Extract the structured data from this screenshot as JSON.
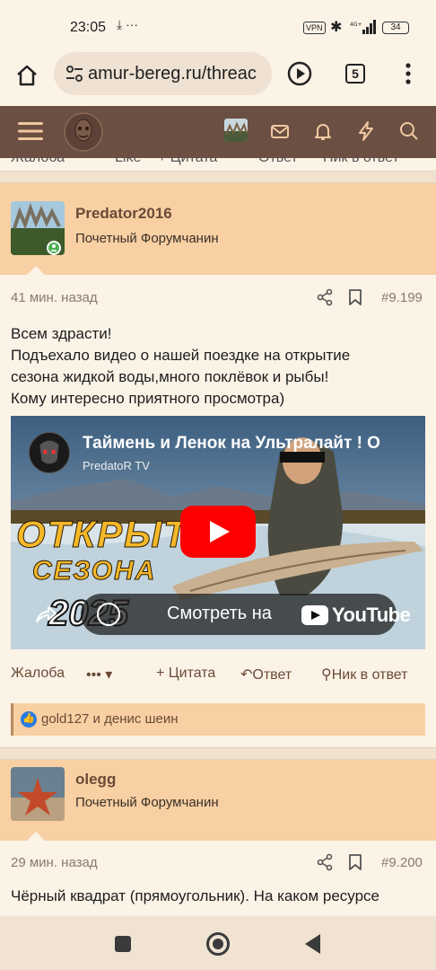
{
  "status": {
    "time": "23:05",
    "left_icons": "⤓ ···",
    "vpn": "VPN",
    "battery": "34"
  },
  "browser": {
    "url": "amur-bereg.ru/threac",
    "tab_count": "5"
  },
  "clipped_actions": {
    "complaint": "Жалоба",
    "like": "Like",
    "quote": "+ Цитата",
    "reply": "Ответ",
    "nick": "Ник в ответ"
  },
  "post1": {
    "username": "Predator2016",
    "rank": "Почетный Форумчанин",
    "time": "41 мин. назад",
    "number": "#9.199",
    "lines": [
      "Всем здрасти!",
      "Подъехало видео о нашей поездке на открытие",
      "сезона жидкой воды,много поклёвок и рыбы!",
      "Кому интересно приятного просмотра)"
    ],
    "video": {
      "title": "Таймень и Ленок на Ультралайт ! О",
      "channel": "PredatoR TV",
      "overlay_line1": "ОТКРЫТ",
      "overlay_line2": "СЕЗОНА",
      "overlay_line3": "2025",
      "watch_on": "Смотреть на",
      "youtube": "YouTube"
    },
    "actions": {
      "complaint": "Жалоба",
      "more": "••• ▾",
      "quote": "+ Цитата",
      "reply": "Ответ",
      "nick": "Ник в ответ"
    },
    "reactions": "gold127 и денис шеин"
  },
  "post2": {
    "username": "olegg",
    "rank": "Почетный Форумчанин",
    "time": "29 мин. назад",
    "number": "#9.200",
    "text": "Чёрный квадрат (прямоугольник). На каком ресурсе"
  },
  "colors": {
    "header_brown": "#6b4f42",
    "user_band": "#f8d0a3",
    "page_bg": "#fcf3e7",
    "link_brown": "#6a4a36",
    "youtube_red": "#ff0000"
  }
}
